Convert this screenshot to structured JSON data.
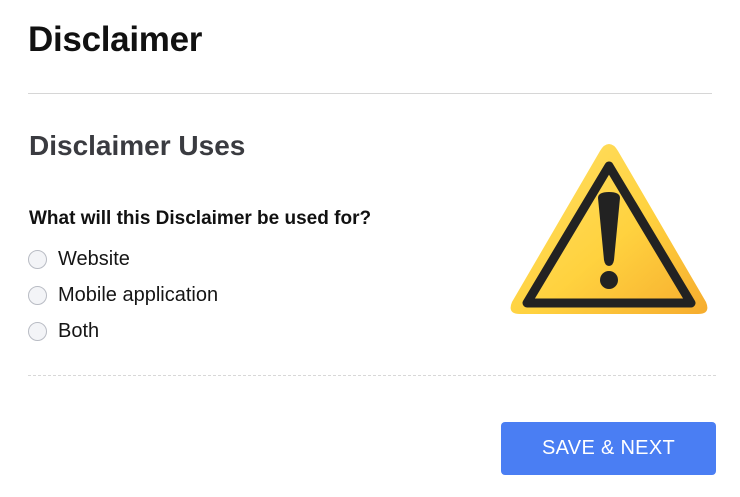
{
  "page": {
    "title": "Disclaimer"
  },
  "section": {
    "title": "Disclaimer Uses",
    "question": "What will this Disclaimer be used for?",
    "options": [
      {
        "label": "Website",
        "selected": false
      },
      {
        "label": "Mobile application",
        "selected": false
      },
      {
        "label": "Both",
        "selected": false
      }
    ]
  },
  "illustration": {
    "icon": "warning-triangle-icon",
    "colors": {
      "fill_light": "#ffd84a",
      "fill_dark": "#f7b733",
      "stroke": "#222222"
    }
  },
  "actions": {
    "save_label": "SAVE & NEXT",
    "save_color": "#4a7ef3"
  }
}
